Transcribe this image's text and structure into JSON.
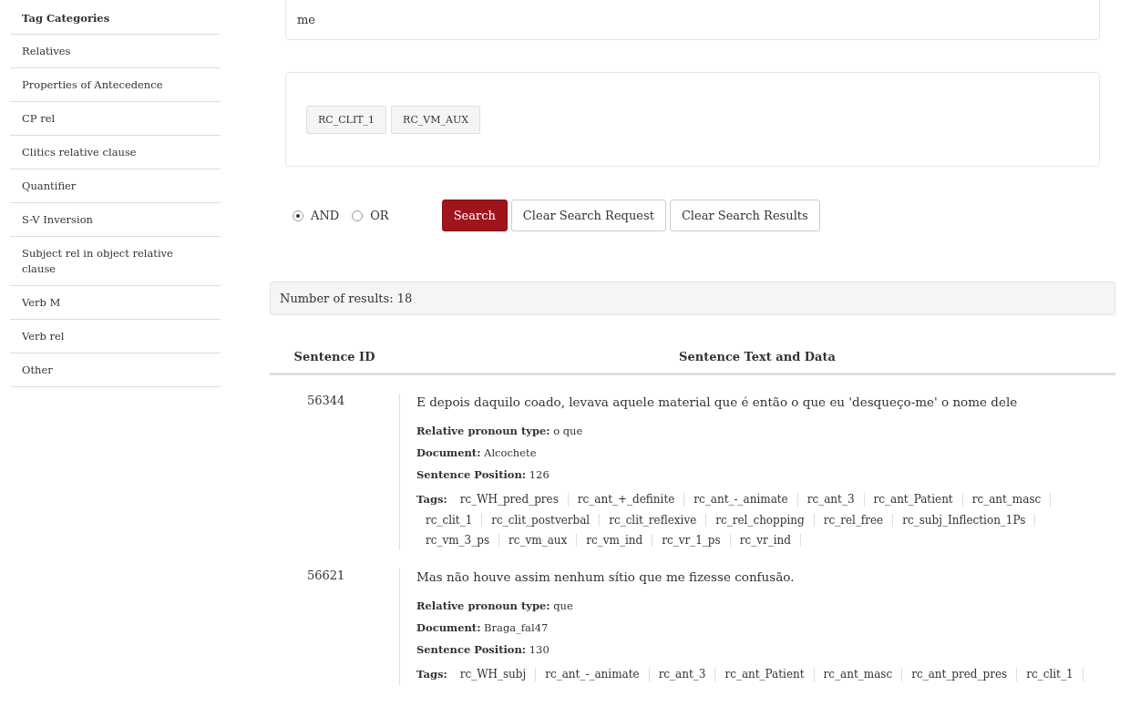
{
  "sidebar": {
    "title": "Tag Categories",
    "items": [
      {
        "label": "Relatives"
      },
      {
        "label": "Properties of Antecedence"
      },
      {
        "label": "CP rel"
      },
      {
        "label": "Clitics relative clause"
      },
      {
        "label": "Quantifier"
      },
      {
        "label": "S-V Inversion"
      },
      {
        "label": "Subject rel in object relative clause"
      },
      {
        "label": "Verb M"
      },
      {
        "label": "Verb rel"
      },
      {
        "label": "Other"
      }
    ]
  },
  "search_field": {
    "value": "me"
  },
  "selected_tags": [
    "RC_CLIT_1",
    "RC_VM_AUX"
  ],
  "operators": [
    {
      "label": "AND",
      "selected": true
    },
    {
      "label": "OR",
      "selected": false
    }
  ],
  "buttons": [
    {
      "label": "Search",
      "kind": "primary"
    },
    {
      "label": "Clear Search Request",
      "kind": "default"
    },
    {
      "label": "Clear Search Results",
      "kind": "default"
    }
  ],
  "results_count": "Number of results: 18",
  "table": {
    "columns": [
      "Sentence ID",
      "Sentence Text and Data"
    ],
    "rows": [
      {
        "id": "56344",
        "text": "E depois daquilo coado, levava aquele material que é então o que eu 'desqueço-me' o nome dele",
        "fields": [
          "**Relative pronoun type:** o que",
          "**Document:** Alcochete",
          "**Sentence Position:** 126"
        ],
        "tags_label": "Tags:",
        "tags": [
          "rc_WH_pred_pres",
          "rc_ant_+_definite",
          "rc_ant_-_animate",
          "rc_ant_3",
          "rc_ant_Patient",
          "rc_ant_masc",
          "rc_clit_1",
          "rc_clit_postverbal",
          "rc_clit_reflexive",
          "rc_rel_chopping",
          "rc_rel_free",
          "rc_subj_Inflection_1Ps",
          "rc_vm_3_ps",
          "rc_vm_aux",
          "rc_vm_ind",
          "rc_vr_1_ps",
          "rc_vr_ind"
        ]
      },
      {
        "id": "56621",
        "text": "Mas não houve assim nenhum sítio que me fizesse confusão.",
        "fields": [
          "**Relative pronoun type:** que",
          "**Document:** Braga_fal47",
          "**Sentence Position:** 130"
        ],
        "tags_label": "Tags:",
        "tags": [
          "rc_WH_subj",
          "rc_ant_-_animate",
          "rc_ant_3",
          "rc_ant_Patient",
          "rc_ant_masc",
          "rc_ant_pred_pres",
          "rc_clit_1"
        ]
      }
    ]
  }
}
